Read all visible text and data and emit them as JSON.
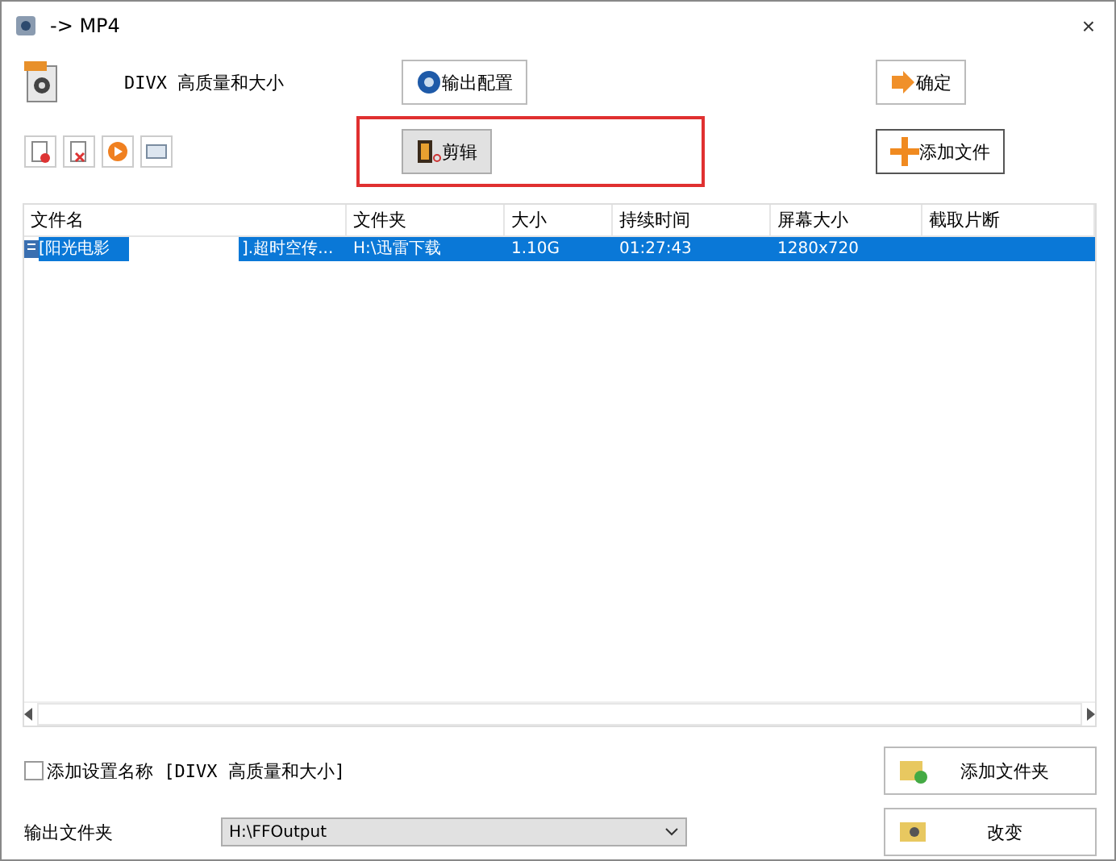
{
  "window": {
    "title": "-> MP4",
    "close": "×"
  },
  "profile": {
    "label": "DIVX 高质量和大小"
  },
  "buttons": {
    "output_config": "输出配置",
    "ok": "确定",
    "edit": "剪辑",
    "add_file": "添加文件",
    "add_folder": "添加文件夹",
    "change": "改变"
  },
  "edit_highlighted": true,
  "table": {
    "columns": [
      "文件名",
      "文件夹",
      "大小",
      "持续时间",
      "屏幕大小",
      "截取片断"
    ],
    "rows": [
      {
        "selected": true,
        "name_start": "[阳光电影",
        "name_end": "].超时空传...",
        "folder": "H:\\迅雷下载",
        "size": "1.10G",
        "duration": "01:27:43",
        "screen": "1280x720"
      }
    ]
  },
  "add_setting_name": {
    "label": "添加设置名称 [DIVX 高质量和大小]",
    "checked": false
  },
  "output_folder": {
    "label": "输出文件夹",
    "value": "H:\\FFOutput"
  }
}
